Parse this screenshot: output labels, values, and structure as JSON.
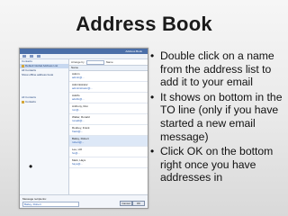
{
  "slide": {
    "title": "Address Book",
    "bullets": [
      "Double click on a name from the address list to add it to your email",
      "It shows on bottom in the TO line (only if you have started a new email message)",
      "Click OK on the bottom right once you have addresses in"
    ],
    "left_bullet": "•"
  },
  "screenshot": {
    "window_title": "Address Book",
    "left_pane": {
      "items": [
        "Contacts",
        "Default Global Address List",
        "All Contacts",
        "Show offline address book",
        "All Contacts",
        "Contacts"
      ]
    },
    "search": {
      "label": "Arrange by",
      "value": "Name"
    },
    "column_header": "Name",
    "contacts": [
      {
        "name": "Admin",
        "email": "admin@..."
      },
      {
        "name": "Administrator",
        "email": "administrator@..."
      },
      {
        "name": "Adolfo",
        "email": "adolfo@..."
      },
      {
        "name": "Anthony, Ron",
        "email": "ron@..."
      },
      {
        "name": "Walter, Ronald",
        "email": "ronald@..."
      },
      {
        "name": "Rodney, Frank",
        "email": "frank@..."
      },
      {
        "name": "Bailey, Robert",
        "email": "robert@..."
      },
      {
        "name": "Lee, HO",
        "email": "ho@..."
      },
      {
        "name": "Mark, Hays",
        "email": "hays@..."
      }
    ],
    "bottom": {
      "to_label": "Message recipients:",
      "to_value": "Bailey, Robert",
      "ok_label": "OK",
      "cancel_label": "Cancel"
    }
  },
  "colors": {
    "titlebar": "#4a6ea8",
    "link": "#2b5fb5"
  }
}
